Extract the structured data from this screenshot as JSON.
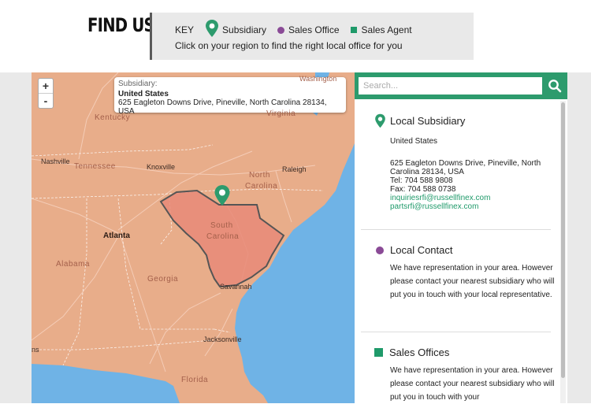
{
  "header": {
    "title": "FIND US",
    "key_label": "KEY",
    "legend": {
      "subsidiary": "Subsidiary",
      "sales_office": "Sales Office",
      "sales_agent": "Sales Agent"
    },
    "description": "Click on your region to find the right local office for you"
  },
  "colors": {
    "brand_green": "#2d9b6d",
    "sales_office_purple": "#8a4a96",
    "selected_region": "#e88a78"
  },
  "map": {
    "zoom_in": "+",
    "zoom_out": "-",
    "popup": {
      "label": "Subsidiary:",
      "name": "United States",
      "address": "625 Eagleton Downs Drive, Pineville, North Carolina 28134, USA"
    },
    "labels": {
      "washington": "Washington",
      "kentucky": "Kentucky",
      "virginia": "Virginia",
      "nashville": "Nashville",
      "tennessee": "Tennessee",
      "knoxville": "Knoxville",
      "raleigh": "Raleigh",
      "north": "North",
      "carolina_n": "Carolina",
      "south": "South",
      "carolina_s": "Carolina",
      "atlanta": "Atlanta",
      "alabama": "Alabama",
      "georgia": "Georgia",
      "savannah": "Savannah",
      "jacksonville": "Jacksonville",
      "florida": "Florida",
      "edge_ns": "ns"
    },
    "selected_region": "South Carolina"
  },
  "search": {
    "placeholder": "Search..."
  },
  "panel": {
    "local_subsidiary": {
      "heading": "Local Subsidiary",
      "country": "United States",
      "address_line1": "625 Eagleton Downs Drive, Pineville, North",
      "address_line2": "Carolina 28134, USA",
      "tel": "Tel: 704 588 9808",
      "fax": "Fax: 704 588 0738",
      "email1": "inquiriesrfi@russellfinex.com",
      "email2": "partsrfi@russellfinex.com"
    },
    "local_contact": {
      "heading": "Local Contact",
      "text": "We have representation in your area. However please contact your nearest subsidiary who will put you in touch with your local representative."
    },
    "sales_offices": {
      "heading": "Sales Offices",
      "text": "We have representation in your area. However please contact your nearest subsidiary who will put you in touch with your"
    }
  }
}
